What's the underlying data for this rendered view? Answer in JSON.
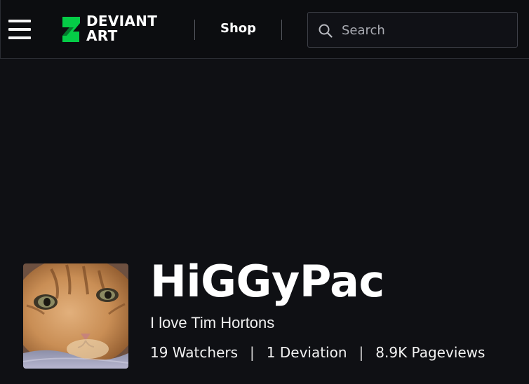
{
  "header": {
    "logo": {
      "line1": "DEVIANT",
      "line2": "ART",
      "accent_color": "#05cc47"
    },
    "shop_label": "Shop",
    "search": {
      "placeholder": "Search",
      "value": ""
    }
  },
  "profile": {
    "username": "HiGGyPac",
    "tagline": "I love Tim Hortons",
    "stats": {
      "watchers": "19 Watchers",
      "deviations": "1 Deviation",
      "pageviews": "8.9K Pageviews",
      "separator": "|"
    },
    "avatar_icon": "cat-avatar"
  },
  "icons": {
    "menu": "hamburger-menu-icon",
    "search": "search-icon",
    "logo": "deviantart-logo-icon"
  },
  "colors": {
    "background": "#0f1014",
    "topbar": "#0c0d10",
    "text": "#ffffff",
    "brand_green": "#05cc47"
  }
}
